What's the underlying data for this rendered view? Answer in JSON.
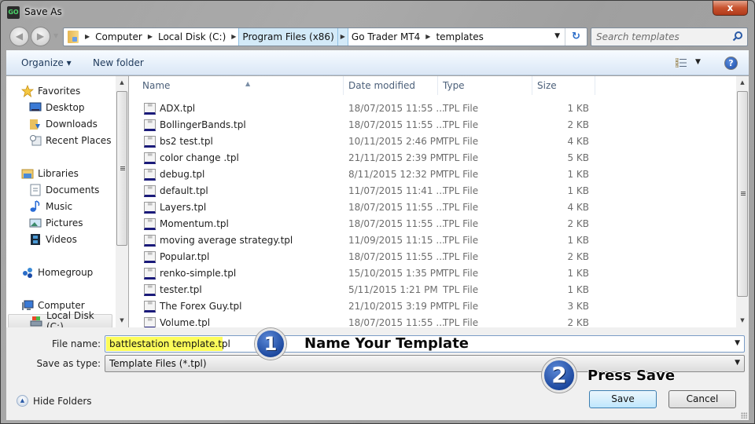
{
  "window": {
    "app_icon_text": "GO",
    "title": "Save As",
    "close_label": "x"
  },
  "nav": {
    "back_icon": "arrow-left",
    "forward_icon": "arrow-right",
    "breadcrumb": [
      "Computer",
      "Local Disk (C:)",
      "Program Files (x86)",
      "Go Trader MT4",
      "templates"
    ],
    "highlighted_crumb_index": 2,
    "refresh_icon": "refresh",
    "search_placeholder": "Search templates"
  },
  "toolbar": {
    "organize_label": "Organize ▾",
    "new_folder_label": "New folder",
    "view_icon": "details-view",
    "help_label": "?"
  },
  "sidebar": {
    "items": [
      {
        "label": "Favorites",
        "icon": "star",
        "level": 0
      },
      {
        "label": "Desktop",
        "icon": "desktop",
        "level": 1
      },
      {
        "label": "Downloads",
        "icon": "downloads-folder",
        "level": 1
      },
      {
        "label": "Recent Places",
        "icon": "recent-places",
        "level": 1
      },
      {
        "label": "Libraries",
        "icon": "libraries-folder",
        "level": 0
      },
      {
        "label": "Documents",
        "icon": "document",
        "level": 1
      },
      {
        "label": "Music",
        "icon": "music-note",
        "level": 1
      },
      {
        "label": "Pictures",
        "icon": "picture",
        "level": 1
      },
      {
        "label": "Videos",
        "icon": "film",
        "level": 1
      },
      {
        "label": "Homegroup",
        "icon": "homegroup",
        "level": 0
      },
      {
        "label": "Computer",
        "icon": "computer",
        "level": 0
      },
      {
        "label": "Local Disk (C:)",
        "icon": "disk-drive",
        "level": 1,
        "selected": true
      }
    ]
  },
  "file_list": {
    "columns": [
      "Name",
      "Date modified",
      "Type",
      "Size"
    ],
    "rows": [
      {
        "name": "ADX.tpl",
        "date": "18/07/2015 11:55 ...",
        "type": "TPL File",
        "size": "1 KB"
      },
      {
        "name": "BollingerBands.tpl",
        "date": "18/07/2015 11:55 ...",
        "type": "TPL File",
        "size": "2 KB"
      },
      {
        "name": "bs2 test.tpl",
        "date": "10/11/2015 2:46 PM",
        "type": "TPL File",
        "size": "4 KB"
      },
      {
        "name": "color change .tpl",
        "date": "21/11/2015 2:39 PM",
        "type": "TPL File",
        "size": "5 KB"
      },
      {
        "name": "debug.tpl",
        "date": "8/11/2015 12:32 PM",
        "type": "TPL File",
        "size": "1 KB"
      },
      {
        "name": "default.tpl",
        "date": "11/07/2015 11:41 ...",
        "type": "TPL File",
        "size": "1 KB"
      },
      {
        "name": "Layers.tpl",
        "date": "18/07/2015 11:55 ...",
        "type": "TPL File",
        "size": "4 KB"
      },
      {
        "name": "Momentum.tpl",
        "date": "18/07/2015 11:55 ...",
        "type": "TPL File",
        "size": "2 KB"
      },
      {
        "name": "moving average strategy.tpl",
        "date": "11/09/2015 11:15 ...",
        "type": "TPL File",
        "size": "1 KB"
      },
      {
        "name": "Popular.tpl",
        "date": "18/07/2015 11:55 ...",
        "type": "TPL File",
        "size": "2 KB"
      },
      {
        "name": "renko-simple.tpl",
        "date": "15/10/2015 1:35 PM",
        "type": "TPL File",
        "size": "1 KB"
      },
      {
        "name": "tester.tpl",
        "date": "5/11/2015 1:21 PM",
        "type": "TPL File",
        "size": "1 KB"
      },
      {
        "name": "The Forex Guy.tpl",
        "date": "21/10/2015 3:19 PM",
        "type": "TPL File",
        "size": "3 KB"
      },
      {
        "name": "Volume.tpl",
        "date": "18/07/2015 11:55 ...",
        "type": "TPL File",
        "size": "2 KB"
      }
    ]
  },
  "form": {
    "file_name_label": "File name:",
    "file_name_value": "battlestation template.tpl",
    "save_type_label": "Save as type:",
    "save_type_value": "Template Files (*.tpl)",
    "hide_folders_label": "Hide Folders",
    "save_label": "Save",
    "cancel_label": "Cancel"
  },
  "annotations": {
    "step1_number": "1",
    "step1_text": "Name Your Template",
    "step2_number": "2",
    "step2_text": "Press Save"
  },
  "colors": {
    "highlight_yellow": "#fcfc5a",
    "badge_blue": "#1e4aa0",
    "breadcrumb_highlight": "#d3eaf8"
  }
}
